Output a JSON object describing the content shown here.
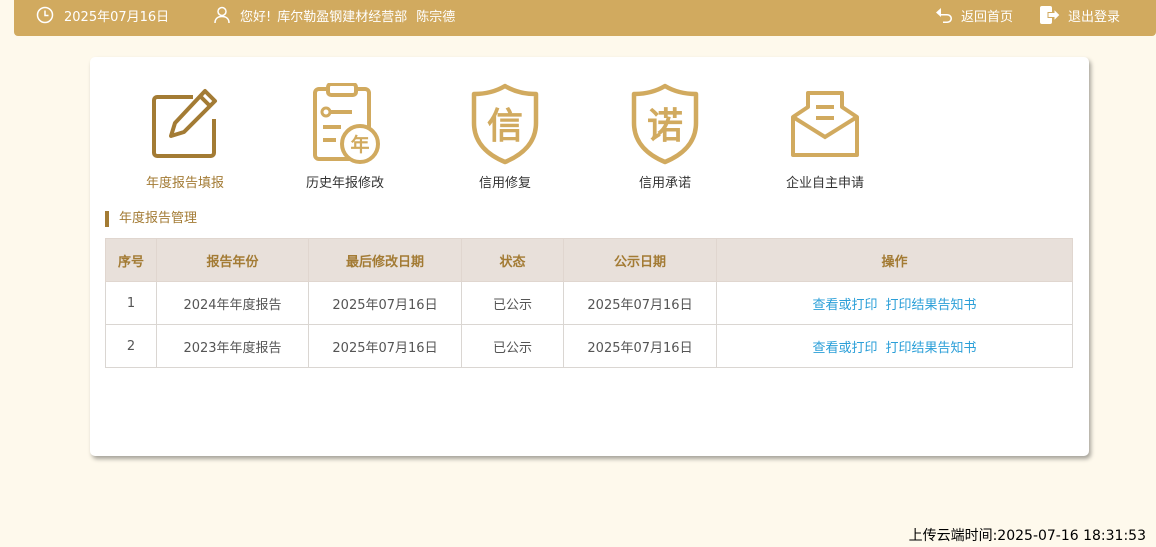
{
  "header": {
    "date": "2025年07月16日",
    "greeting": "您好!",
    "company": "库尔勒盈钢建材经营部",
    "user": "陈宗德",
    "home_label": "返回首页",
    "logout_label": "退出登录"
  },
  "nav": [
    {
      "label": "年度报告填报",
      "icon": "edit-report-icon"
    },
    {
      "label": "历史年报修改",
      "icon": "history-report-icon"
    },
    {
      "label": "信用修复",
      "icon": "credit-repair-shield-icon",
      "glyph": "信"
    },
    {
      "label": "信用承诺",
      "icon": "credit-promise-shield-icon",
      "glyph": "诺"
    },
    {
      "label": "企业自主申请",
      "icon": "envelope-apply-icon"
    }
  ],
  "history_badge": "年",
  "section": {
    "title": "年度报告管理"
  },
  "table": {
    "headers": [
      "序号",
      "报告年份",
      "最后修改日期",
      "状态",
      "公示日期",
      "操作"
    ],
    "rows": [
      {
        "no": "1",
        "report": "2024年年度报告",
        "modified": "2025年07月16日",
        "status": "已公示",
        "public": "2025年07月16日",
        "op1": "查看或打印",
        "op2": "打印结果告知书"
      },
      {
        "no": "2",
        "report": "2023年年度报告",
        "modified": "2025年07月16日",
        "status": "已公示",
        "public": "2025年07月16日",
        "op1": "查看或打印",
        "op2": "打印结果告知书"
      }
    ]
  },
  "footer": {
    "upload_time": "上传云端时间:2025-07-16 18:31:53"
  },
  "colors": {
    "accent": "#d1aa5f",
    "accent_dark": "#a37b34",
    "link": "#2b9fd8",
    "page_bg": "#fef9ec"
  }
}
